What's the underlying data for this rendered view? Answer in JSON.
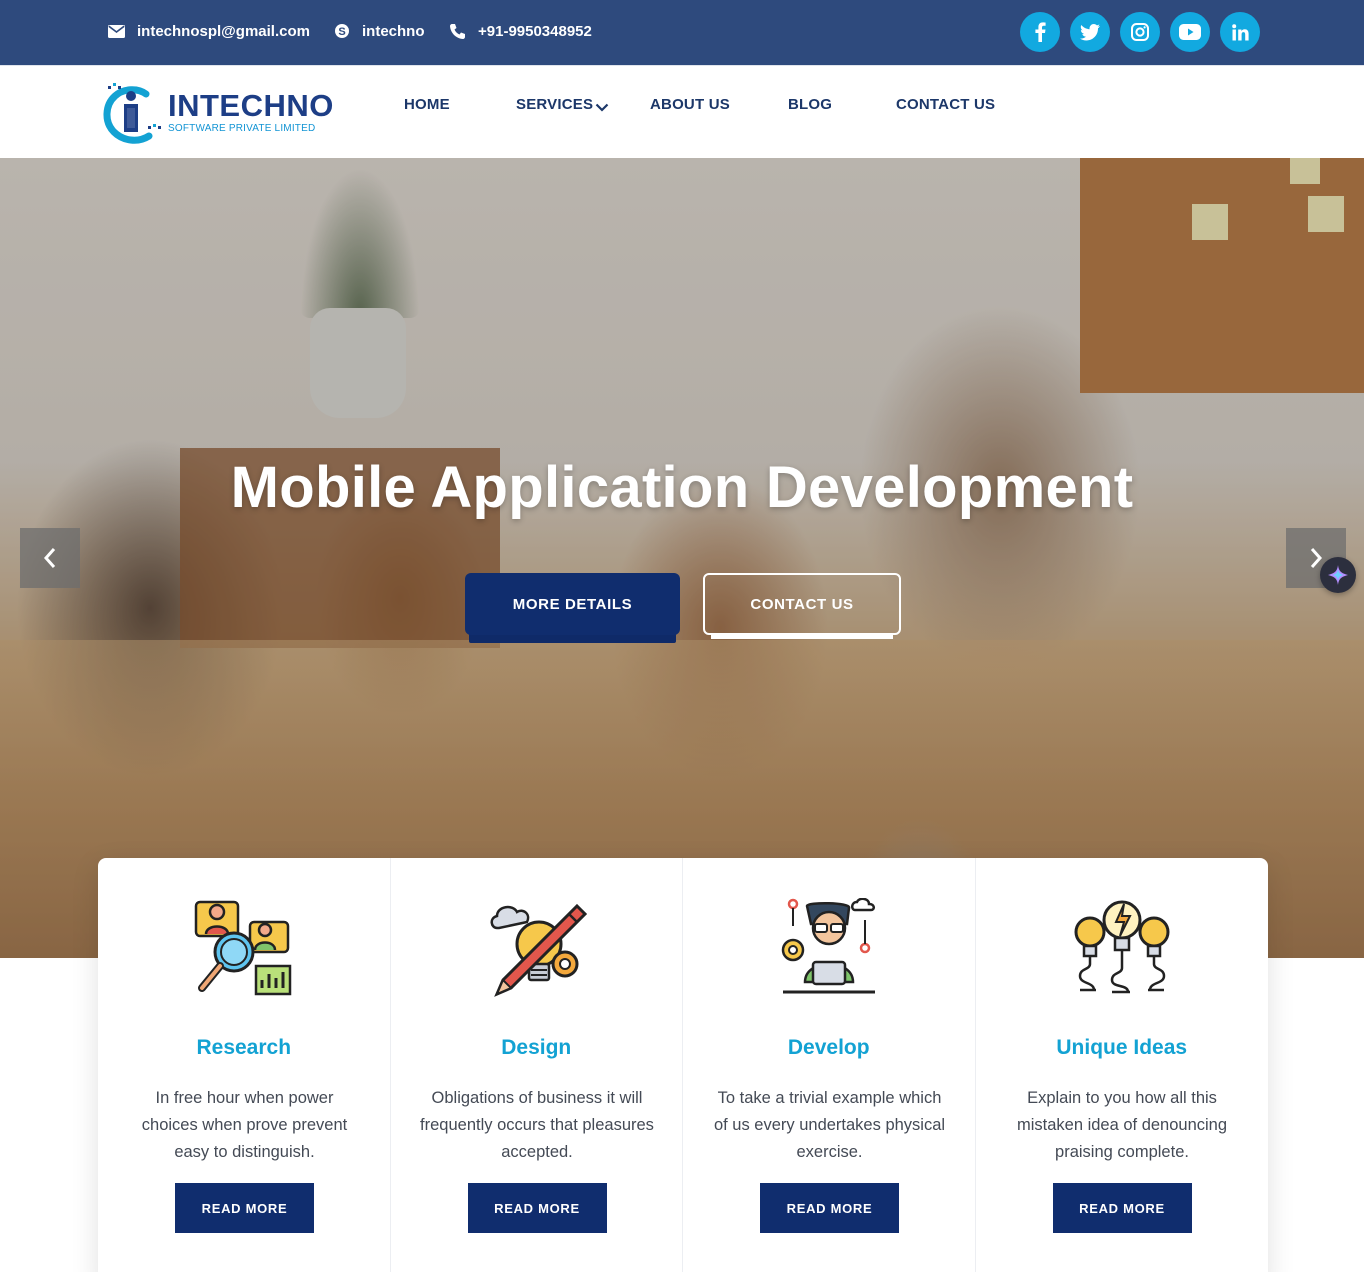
{
  "topbar": {
    "email": "intechnospl@gmail.com",
    "skype": "intechno",
    "phone": "+91-9950348952",
    "social_icons": [
      "facebook-icon",
      "twitter-icon",
      "instagram-icon",
      "youtube-icon",
      "linkedin-icon"
    ]
  },
  "brand": {
    "name": "INTECHNO",
    "tagline": "SOFTWARE PRIVATE LIMITED"
  },
  "nav": {
    "home": "HOME",
    "services": "SERVICES",
    "about": "ABOUT US",
    "blog": "BLOG",
    "contact": "CONTACT US"
  },
  "hero": {
    "title": "Mobile Application Development",
    "primary_button": "MORE DETAILS",
    "secondary_button": "CONTACT US"
  },
  "features": [
    {
      "title": "Research",
      "description": "In free hour when power choices when prove prevent easy to distinguish.",
      "button": "READ MORE",
      "icon": "research-icon"
    },
    {
      "title": "Design",
      "description": "Obligations of business it will frequently occurs that pleasures accepted.",
      "button": "READ MORE",
      "icon": "design-icon"
    },
    {
      "title": "Develop",
      "description": "To take a trivial example which of us every undertakes physical exercise.",
      "button": "READ MORE",
      "icon": "develop-icon"
    },
    {
      "title": "Unique Ideas",
      "description": "Explain to you how all this mistaken idea of denouncing praising complete.",
      "button": "READ MORE",
      "icon": "ideas-icon"
    }
  ],
  "colors": {
    "topbar": "#2e4a7d",
    "accent": "#12a9e0",
    "navy": "#102d6e",
    "title_blue": "#13a2d3"
  }
}
